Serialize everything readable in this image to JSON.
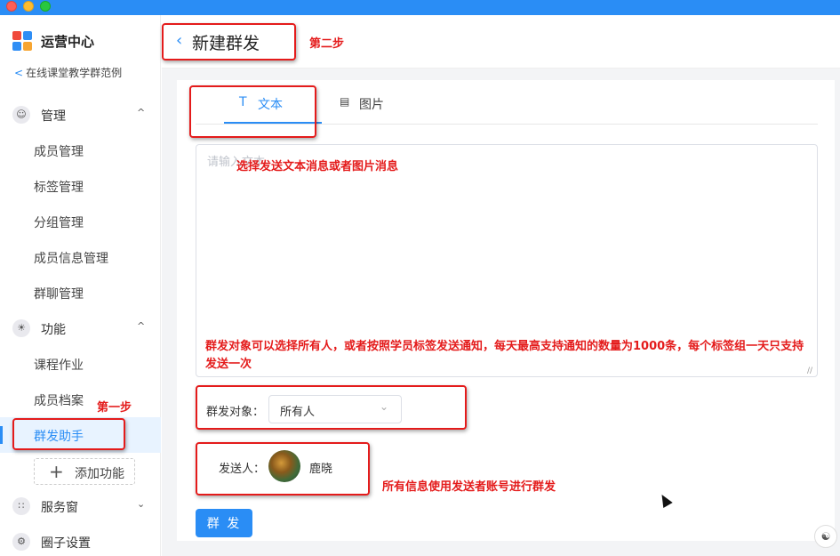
{
  "sidebar": {
    "app_title": "运营中心",
    "back_link": "在线课堂教学群范例",
    "groups": [
      {
        "label": "管理",
        "icon": "user-gear-icon",
        "arrow": "^"
      },
      {
        "label": "功能",
        "icon": "bulb-icon",
        "arrow": "^"
      },
      {
        "label": "服务窗",
        "icon": "grid-icon",
        "arrow": "⌄"
      },
      {
        "label": "圈子设置",
        "icon": "gear-icon"
      }
    ],
    "items": [
      {
        "label": "成员管理"
      },
      {
        "label": "标签管理"
      },
      {
        "label": "分组管理"
      },
      {
        "label": "成员信息管理"
      },
      {
        "label": "群聊管理"
      },
      {
        "label": "课程作业"
      },
      {
        "label": "成员档案"
      },
      {
        "label": "群发助手",
        "active": true
      }
    ],
    "add_function": "添加功能"
  },
  "header": {
    "title": "新建群发"
  },
  "tabs": [
    {
      "label": "文本",
      "icon": "text-T-icon",
      "active": true
    },
    {
      "label": "图片",
      "icon": "image-icon",
      "active": false
    }
  ],
  "message": {
    "placeholder": "请输入文本"
  },
  "audience": {
    "label": "群发对象：",
    "selected": "所有人"
  },
  "sender": {
    "label": "发送人：",
    "name": "鹿晓"
  },
  "send_button": "群 发",
  "annotations": {
    "step1": "第一步",
    "step2": "第二步",
    "tab_note": "选择发送文本消息或者图片消息",
    "audience_note": "群发对象可以选择所有人，或者按照学员标签发送通知，每天最高支持通知的数量为1000条，每个标签组一天只支持发送一次",
    "sender_note": "所有信息使用发送者账号进行群发"
  },
  "colors": {
    "accent": "#2a8df5",
    "annotation": "#e41b1b",
    "titlebar": "#2a8df5"
  }
}
